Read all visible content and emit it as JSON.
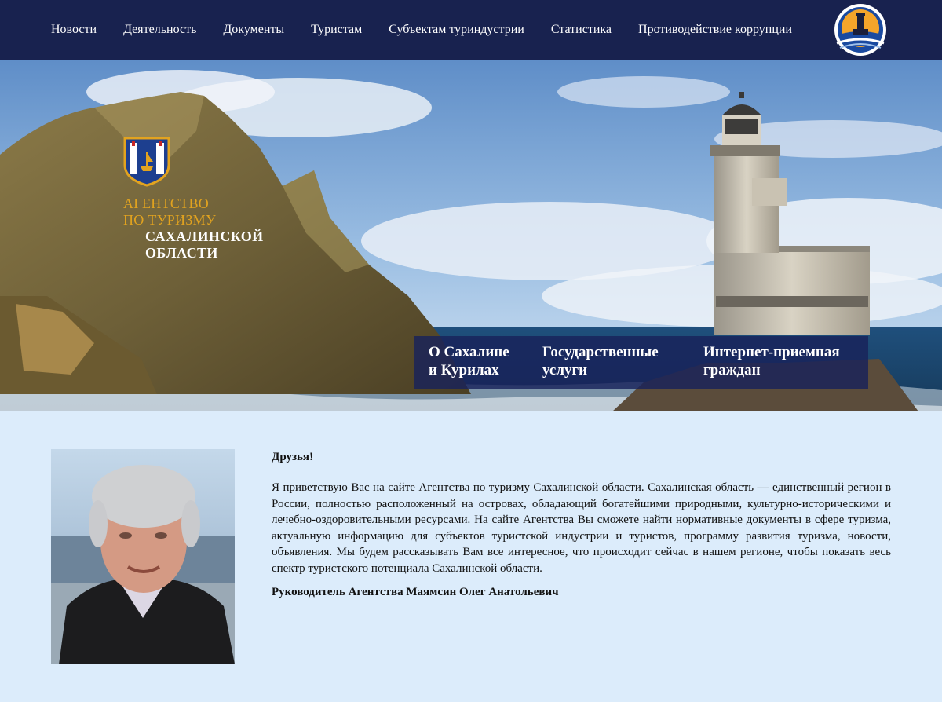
{
  "nav": {
    "items": [
      {
        "label": "Новости"
      },
      {
        "label": "Деятельность"
      },
      {
        "label": "Документы"
      },
      {
        "label": "Туристам"
      },
      {
        "label": "Субъектам туриндустрии"
      },
      {
        "label": "Статистика"
      },
      {
        "label": "Противодействие коррупции"
      }
    ]
  },
  "agency": {
    "line1": "АГЕНТСТВО",
    "line2": "ПО ТУРИЗМУ",
    "line3": "САХАЛИНСКОЙ",
    "line4": "ОБЛАСТИ"
  },
  "quicklinks": [
    {
      "line1": "О Сахалине",
      "line2": "и Курилах"
    },
    {
      "line1": "Государственные",
      "line2": "услуги"
    },
    {
      "line1": "Интернет-приемная",
      "line2": "граждан"
    }
  ],
  "welcome": {
    "greeting": "Друзья!",
    "body": "Я приветствую Вас на сайте Агентства по туризму Сахалинской области. Сахалинская область — единственный регион в России, полностью расположенный на островах, обладающий богатейшими природными, культурно-историческими и лечебно-оздоровительными ресурсами. На сайте Агентства Вы сможете найти нормативные документы в сфере туризма, актуальную информацию для субъектов туристской индустрии и туристов, программу развития туризма, новости, объявления. Мы будем рассказывать Вам все интересное, что происходит сейчас в нашем регионе, чтобы показать весь спектр туристского потенциала Сахалинской области.",
    "signature": "Руководитель Агентства Маямсин Олег Анатольевич"
  },
  "colors": {
    "nav_bg": "#18224f",
    "agency_gold": "#e2a31f",
    "quicklinks_bg": "#18225a",
    "content_bg": "#dcecfb"
  }
}
